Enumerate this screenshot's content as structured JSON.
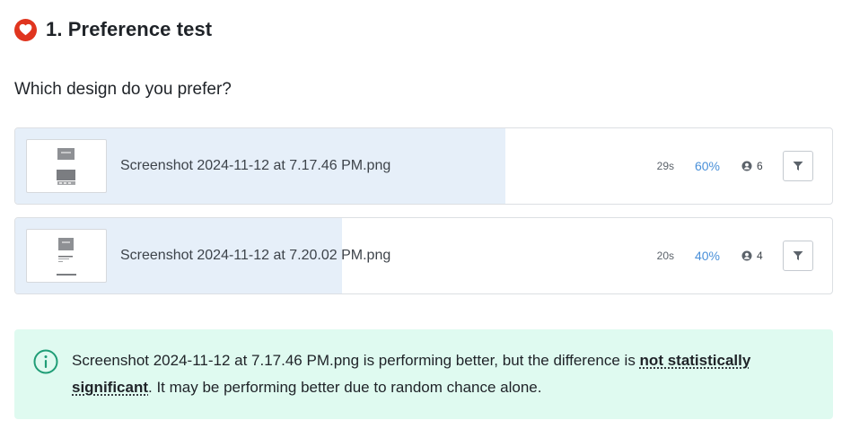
{
  "header": {
    "title": "1. Preference test",
    "icon": "heart-icon",
    "icon_color": "#e0351f"
  },
  "question": "Which design do you prefer?",
  "options": [
    {
      "filename": "Screenshot 2024-11-12 at 7.17.46 PM.png",
      "time": "29s",
      "percent": "60%",
      "share": 0.6,
      "votes": "6"
    },
    {
      "filename": "Screenshot 2024-11-12 at 7.20.02 PM.png",
      "time": "20s",
      "percent": "40%",
      "share": 0.4,
      "votes": "4"
    }
  ],
  "notice": {
    "icon": "info-icon",
    "text_before": "Screenshot 2024-11-12 at 7.17.46 PM.png is performing better, but the difference is ",
    "term": "not statistically significant",
    "text_after": ". It may be performing better due to random chance alone."
  },
  "colors": {
    "fill": "#e6eff9",
    "percent": "#4a90d9",
    "notice_bg": "#dffaf0",
    "notice_icon": "#1f9d76"
  }
}
